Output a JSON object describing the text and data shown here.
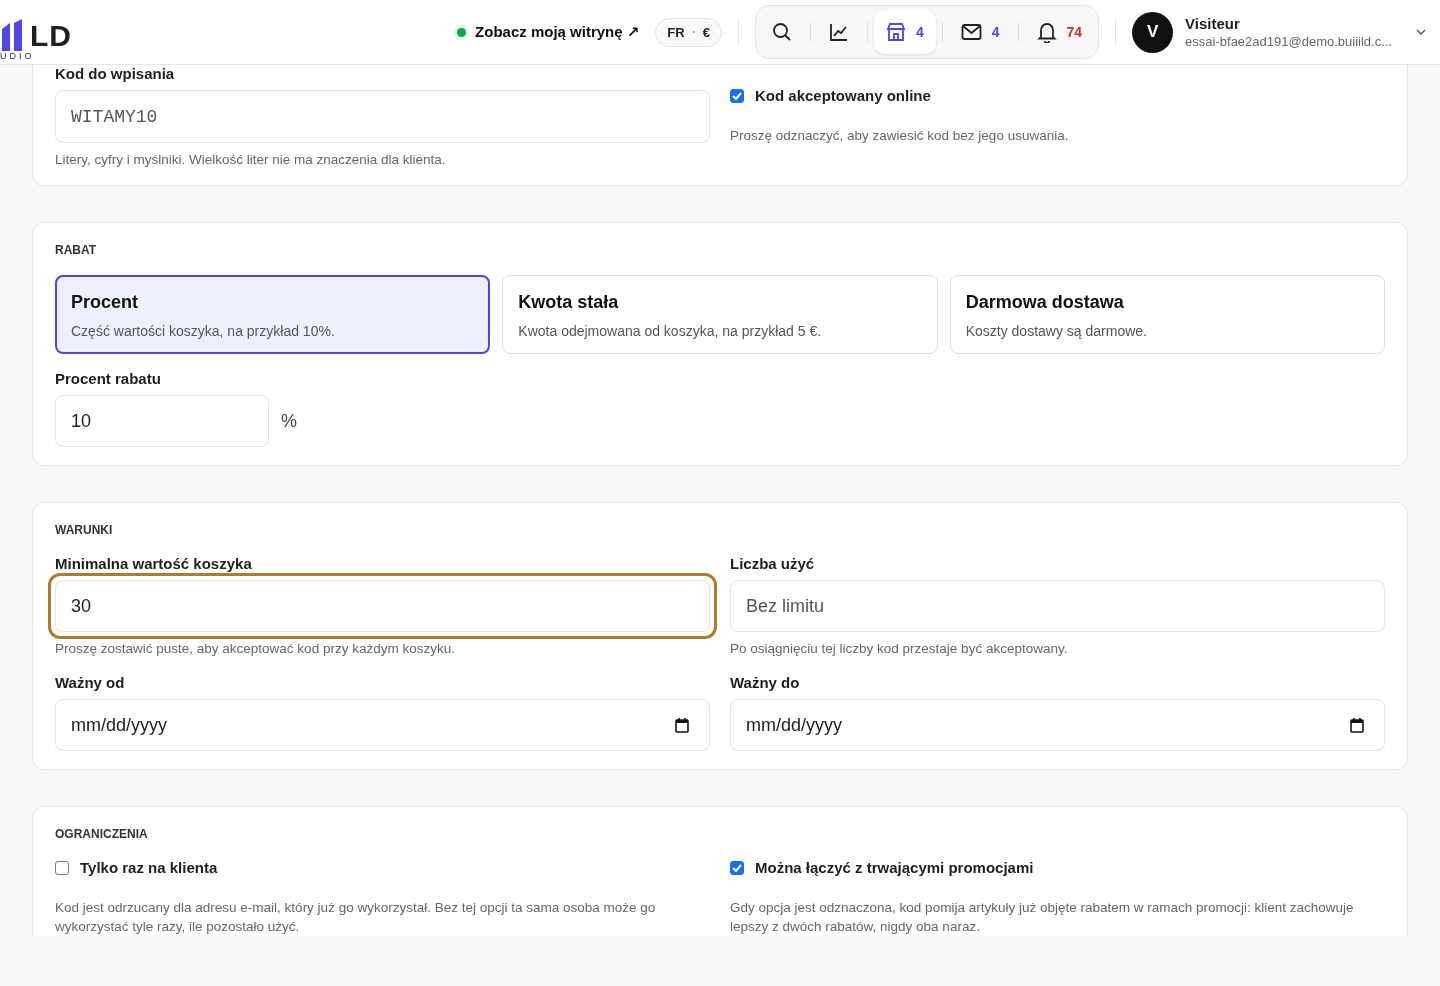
{
  "header": {
    "logo_text": "LD",
    "logo_subtext": "UDIO",
    "site_link": {
      "label": "Zobacz moją witrynę ↗",
      "online": true
    },
    "locale": {
      "language": "FR",
      "currency": "€"
    },
    "toolbar": [
      {
        "kind": "search",
        "selected": false
      },
      {
        "kind": "stats",
        "selected": false
      },
      {
        "kind": "store",
        "count": "4",
        "color": "#4f46e5",
        "selected": true
      },
      {
        "kind": "mail",
        "count": "4",
        "color": "#4f46e5",
        "selected": false
      },
      {
        "kind": "bell",
        "count": "74",
        "color": "#c0392b",
        "selected": false
      }
    ],
    "user": {
      "initial": "V",
      "name": "Visiteur",
      "email": "essai-bfae2ad191@demo.buiiild.c..."
    }
  },
  "code_section": {
    "label": "Kod do wpisania",
    "value": "WITAMY10",
    "help": "Litery, cyfry i myślniki. Wielkość liter nie ma znaczenia dla klienta.",
    "online": {
      "label": "Kod akceptowany online",
      "checked": true,
      "help": "Proszę odznaczyć, aby zawiesić kod bez jego usuwania."
    }
  },
  "discount": {
    "heading": "RABAT",
    "options": [
      {
        "title": "Procent",
        "description": "Część wartości koszyka, na przykład 10%.",
        "selected": true
      },
      {
        "title": "Kwota stała",
        "description": "Kwota odejmowana od koszyka, na przykład 5 €.",
        "selected": false
      },
      {
        "title": "Darmowa dostawa",
        "description": "Koszty dostawy są darmowe.",
        "selected": false
      }
    ],
    "percent_label": "Procent rabatu",
    "percent_value": "10",
    "unit": "%"
  },
  "conditions": {
    "heading": "WARUNKI",
    "fields": [
      {
        "kind": "text",
        "label": "Minimalna wartość koszyka",
        "value": "30",
        "focused": true,
        "help": "Proszę zostawić puste, aby akceptować kod przy każdym koszyku."
      },
      {
        "kind": "text",
        "label": "Liczba użyć",
        "placeholder": "Bez limitu",
        "focused": false,
        "help": "Po osiągnięciu tej liczby kod przestaje być akceptowany."
      },
      {
        "kind": "date",
        "label": "Ważny od",
        "placeholder": "mm/dd/yyyy",
        "focused": false
      },
      {
        "kind": "date",
        "label": "Ważny do",
        "placeholder": "mm/dd/yyyy",
        "focused": false
      }
    ]
  },
  "restrictions": {
    "heading": "OGRANICZENIA",
    "options": [
      {
        "label": "Tylko raz na klienta",
        "checked": false,
        "description": "Kod jest odrzucany dla adresu e-mail, który już go wykorzystał. Bez tej opcji ta sama osoba może go wykorzystać tyle razy, ile pozostało użyć."
      },
      {
        "label": "Można łączyć z trwającymi promocjami",
        "checked": true,
        "description": "Gdy opcja jest odznaczona, kod pomija artykuły już objęte rabatem w ramach promocji: klient zachowuje lepszy z dwóch rabatów, nigdy oba naraz."
      }
    ]
  }
}
